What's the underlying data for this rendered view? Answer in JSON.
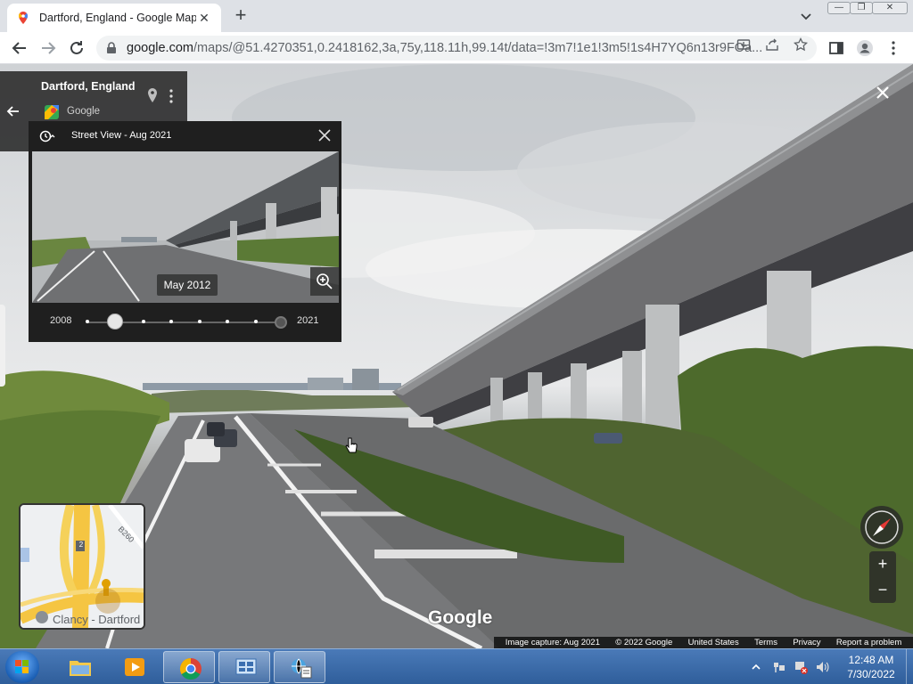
{
  "browser": {
    "tab_title": "Dartford, England - Google Maps",
    "url_host": "google.com",
    "url_path": "/maps/@51.4270351,0.2418162,3a,75y,118.11h,99.14t/data=!3m7!1e1!3m5!1s4H7YQ6n13r9FOa..."
  },
  "header_card": {
    "title": "Dartford, England",
    "subtitle": "Google"
  },
  "time_machine": {
    "title": "Street View - Aug 2021",
    "selected_date": "May 2012",
    "start_year": "2008",
    "end_year": "2021",
    "capture_count": 8,
    "selected_index": 1
  },
  "minimap": {
    "label": "Clancy - Dartford",
    "road_label": "B260",
    "road_shield": "2"
  },
  "watermark": "Google",
  "footer": {
    "image_capture": "Image capture: Aug 2021",
    "copyright": "© 2022 Google",
    "country": "United States",
    "terms": "Terms",
    "privacy": "Privacy",
    "report": "Report a problem"
  },
  "taskbar": {
    "time": "12:48 AM",
    "date": "7/30/2022"
  },
  "colors": {
    "accent_blue": "#1a73e8",
    "taskbar_blue": "#2f5e9b",
    "panel_dark": "#1f1f1f"
  }
}
